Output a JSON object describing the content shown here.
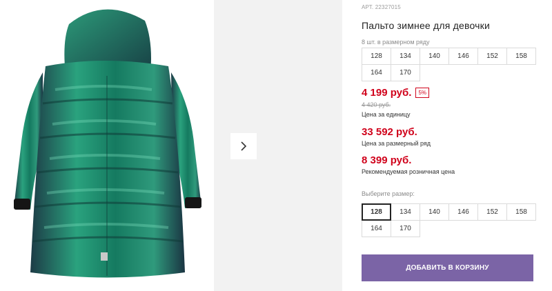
{
  "product": {
    "article": "АРТ. 22327015",
    "title": "Пальто зимнее для девочки",
    "size_count": "8 шт. в размерном ряду",
    "range_sizes": [
      "128",
      "134",
      "140",
      "146",
      "152",
      "158",
      "164",
      "170"
    ],
    "price": "4 199 руб.",
    "discount": "5%",
    "old_price": "4 420 руб.",
    "unit_price_label": "Цена за единицу",
    "range_price": "33 592 руб.",
    "range_price_label": "Цена за размерный ряд",
    "retail_price": "8 399 руб.",
    "retail_price_label": "Рекомендуемая розничная цена",
    "choose_size_label": "Выберите размер:",
    "selectable_sizes": [
      "128",
      "134",
      "140",
      "146",
      "152",
      "158",
      "164",
      "170"
    ],
    "selected_size": "128",
    "add_to_cart_label": "ДОБАВИТЬ В КОРЗИНУ"
  },
  "gallery": {
    "next_icon": "chevron-right-icon"
  },
  "colors": {
    "price_red": "#d0021b",
    "cart_button": "#7b64a6",
    "jacket_green": "#1f8a6a"
  }
}
